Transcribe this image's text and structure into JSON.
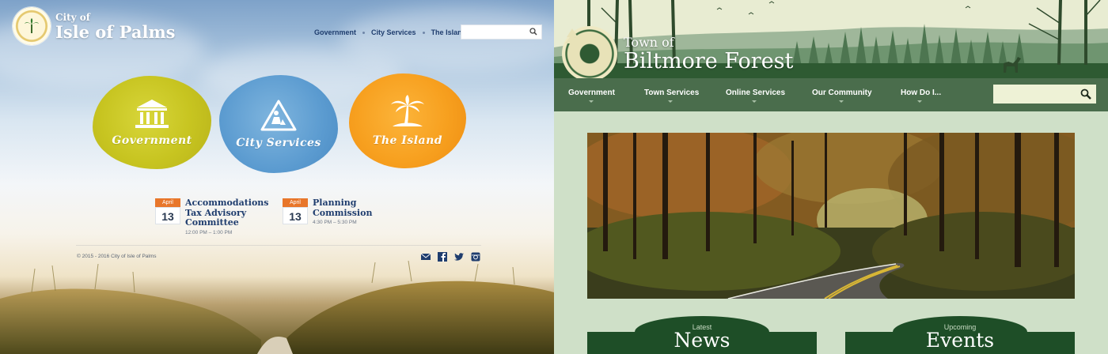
{
  "isle_of_palms": {
    "logo": {
      "line1": "City of",
      "line2": "Isle of Palms"
    },
    "nav": [
      "Government",
      "City Services",
      "The Island"
    ],
    "search": {
      "placeholder": ""
    },
    "tiles": [
      {
        "label": "Government",
        "icon": "building-icon",
        "color": "#c7c420"
      },
      {
        "label": "City Services",
        "icon": "road-work-sign-icon",
        "color": "#5b9bd0"
      },
      {
        "label": "The Island",
        "icon": "palm-tree-icon",
        "color": "#f7a01f"
      }
    ],
    "events": [
      {
        "month": "April",
        "day": "13",
        "title_lines": [
          "Accommodations",
          "Tax Advisory",
          "Committee"
        ],
        "time": "12:00 PM – 1:00 PM"
      },
      {
        "month": "April",
        "day": "13",
        "title_lines": [
          "Planning",
          "Commission"
        ],
        "time": "4:30 PM – 5:30 PM"
      }
    ],
    "copyright": "© 2015 - 2016 City of Isle of Palms",
    "social": [
      "mail-icon",
      "facebook-icon",
      "twitter-icon",
      "instagram-icon"
    ]
  },
  "biltmore_forest": {
    "logo": {
      "line1": "Town of",
      "line2": "Biltmore Forest",
      "seal_text_top": "Town of Biltmore Forest",
      "seal_text_bottom": "North Carolina"
    },
    "nav": [
      "Government",
      "Town Services",
      "Online Services",
      "Our Community",
      "How Do I..."
    ],
    "search": {
      "placeholder": ""
    },
    "cards": [
      {
        "kicker": "Latest",
        "heading": "News"
      },
      {
        "kicker": "Upcoming",
        "heading": "Events"
      }
    ],
    "colors": {
      "nav_bg": "#4a6d4c",
      "page_bg": "#cfe0c8",
      "card_bg": "#1e4e27"
    }
  }
}
